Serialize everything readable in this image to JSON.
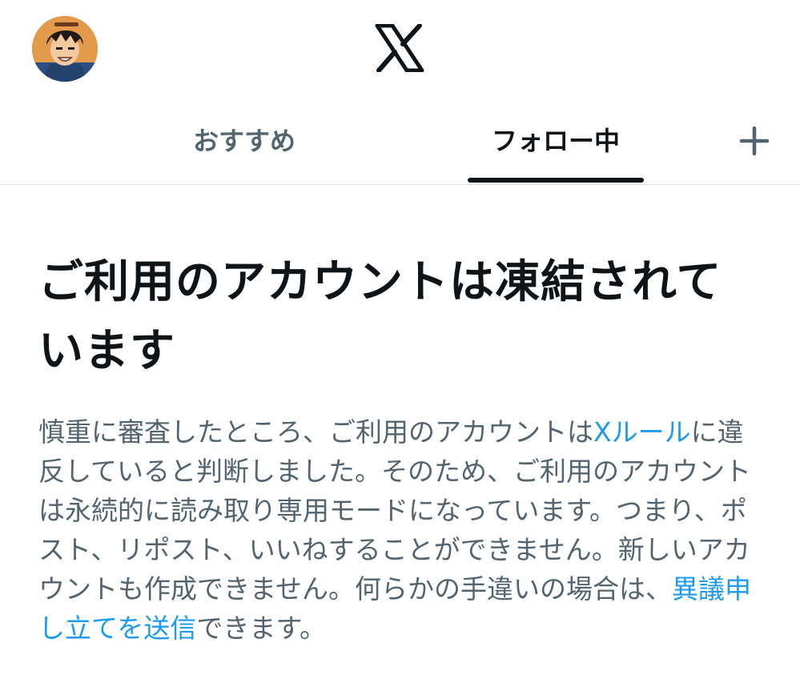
{
  "header": {
    "avatar_icon": "user-avatar-anime-character",
    "logo_icon": "x-logo-icon"
  },
  "tabs": [
    {
      "label": "おすすめ",
      "active": false
    },
    {
      "label": "フォロー中",
      "active": true
    }
  ],
  "add_tab_icon": "plus-icon",
  "notice": {
    "title": "ご利用のアカウントは凍結されています",
    "body_part1": "慎重に審査したところ、ご利用のアカウントは",
    "rules_link": "Xルール",
    "body_part2": "に違反していると判断しました。そのため、ご利用のアカウントは永続的に読み取り専用モードになっています。つまり、ポスト、リポスト、いいねすることができません。新しいアカウントも作成できません。何らかの手違いの場合は、",
    "appeal_link": "異議申し立てを送信",
    "body_part3": "できます。"
  },
  "colors": {
    "text_primary": "#0f1419",
    "text_secondary": "#536471",
    "link": "#1d9bf0",
    "divider": "#e1e4e8"
  }
}
